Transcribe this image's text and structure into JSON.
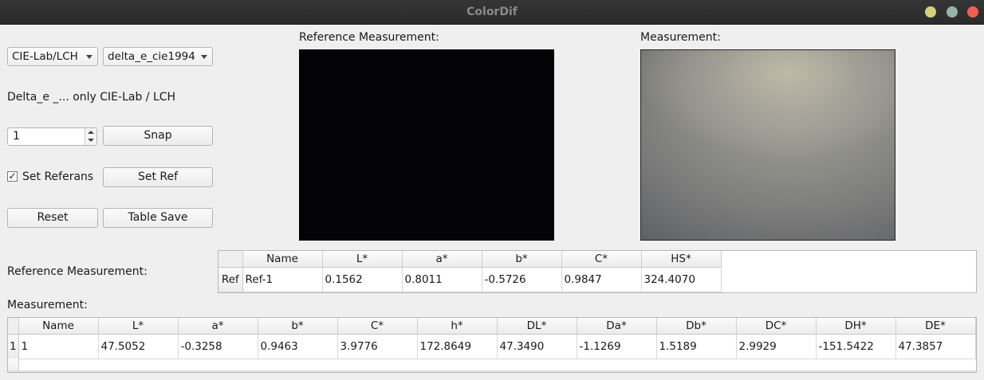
{
  "window": {
    "title": "ColorDif"
  },
  "controls": {
    "colorspace_combo": "CIE-Lab/LCH",
    "delta_combo": "delta_e_cie1994",
    "delta_note": "Delta_e _... only CIE-Lab / LCH",
    "spin_value": "1",
    "snap_label": "Snap",
    "set_referans_label": "Set Referans",
    "set_referans_checked": "✓",
    "set_ref_label": "Set Ref",
    "reset_label": "Reset",
    "table_save_label": "Table Save"
  },
  "views": {
    "reference_label": "Reference Measurement:",
    "measurement_label": "Measurement:"
  },
  "reference_table": {
    "label": "Reference Measurement:",
    "columns": [
      "Name",
      "L*",
      "a*",
      "b*",
      "C*",
      "HS*"
    ],
    "rows": [
      {
        "header": "Ref",
        "cells": [
          "Ref-1",
          "0.1562",
          "0.8011",
          "-0.5726",
          "0.9847",
          "324.4070"
        ]
      }
    ]
  },
  "measurement_table": {
    "label": "Measurement:",
    "columns": [
      "Name",
      "L*",
      "a*",
      "b*",
      "C*",
      "h*",
      "DL*",
      "Da*",
      "Db*",
      "DC*",
      "DH*",
      "DE*"
    ],
    "rows": [
      {
        "header": "1",
        "cells": [
          "1",
          "47.5052",
          "-0.3258",
          "0.9463",
          "3.9776",
          "172.8649",
          "47.3490",
          "-1.1269",
          "1.5189",
          "2.9929",
          "-151.5422",
          "47.3857"
        ]
      }
    ]
  }
}
